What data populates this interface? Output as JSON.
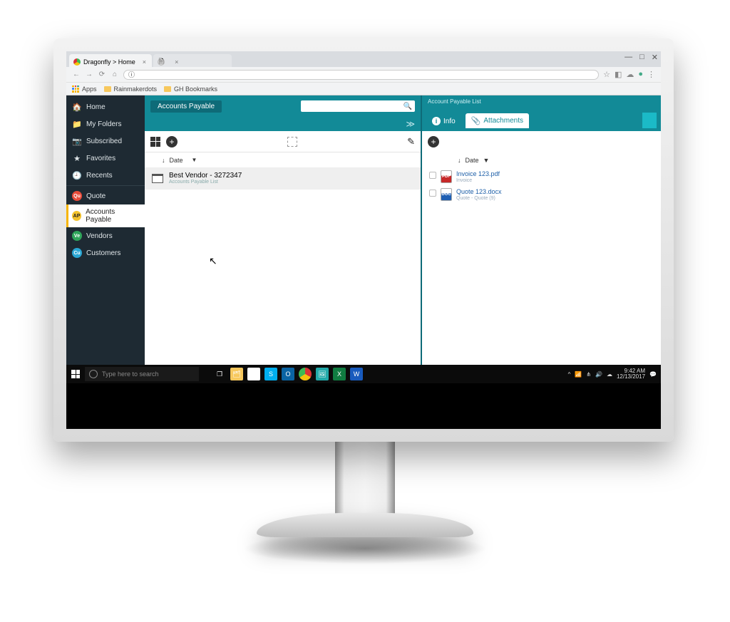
{
  "browser": {
    "tab1_title": "Dragonfly > Home",
    "tab2_title": "",
    "win_min": "—",
    "win_max": "□",
    "win_close": "✕",
    "bookmarks": {
      "apps_label": "Apps",
      "item1": "Rainmakerdots",
      "item2": "GH Bookmarks"
    },
    "omnibox_prefix": "ⓘ",
    "star": "☆"
  },
  "sidebar": {
    "items": [
      {
        "label": "Home",
        "icon": "🏠"
      },
      {
        "label": "My Folders",
        "icon": "📁"
      },
      {
        "label": "Subscribed",
        "icon": "📷"
      },
      {
        "label": "Favorites",
        "icon": "★"
      },
      {
        "label": "Recents",
        "icon": "🕘"
      }
    ],
    "apps": [
      {
        "code": "Qu",
        "label": "Quote",
        "color": "#e84b3a"
      },
      {
        "code": "AP",
        "label": "Accounts Payable",
        "color": "#f3c22b",
        "active": true
      },
      {
        "code": "Ve",
        "label": "Vendors",
        "color": "#2fa55a"
      },
      {
        "code": "Cu",
        "label": "Customers",
        "color": "#2aa7d4"
      }
    ]
  },
  "center": {
    "header_title": "Accounts Payable",
    "expand_icon": "≫",
    "sort_label": "Date",
    "folder": {
      "name": "Best Vendor - 3272347",
      "sub": "Accounts Payable List"
    }
  },
  "right": {
    "header_crumb": "Account Payable List",
    "tab_info": "Info",
    "tab_attach": "Attachments",
    "sort_label": "Date",
    "files": [
      {
        "name": "Invoice 123.pdf",
        "sub": "Invoice",
        "type": "pdf"
      },
      {
        "name": "Quote 123.docx",
        "sub": "Quote - Quote (9)",
        "type": "doc"
      }
    ]
  },
  "taskbar": {
    "search_placeholder": "Type here to search",
    "time": "9:42 AM",
    "date": "12/13/2017"
  }
}
